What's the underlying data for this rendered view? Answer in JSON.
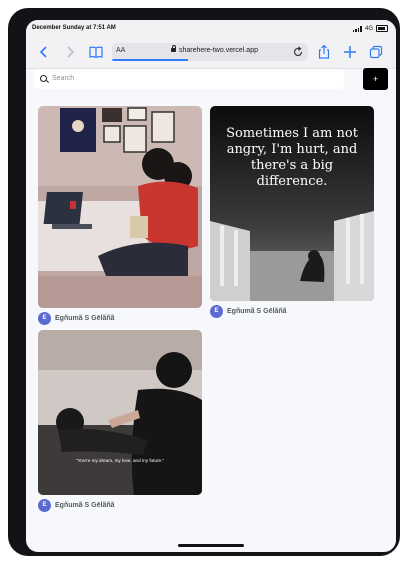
{
  "status_bar": {
    "datetime": "December Sunday at 7:51 AM",
    "network": "4G"
  },
  "browser": {
    "text_size_label": "AA",
    "url": "sharehere-two.vercel.app",
    "icons": [
      "back-icon",
      "forward-icon",
      "bookmarks-icon",
      "lock-icon",
      "reload-icon",
      "share-icon",
      "new-tab-icon",
      "tabs-icon"
    ]
  },
  "header": {
    "search_placeholder": "Search",
    "add_label": "+"
  },
  "pins": [
    {
      "author_initial": "E",
      "author_name": "Egñumã S Gēlãñã"
    },
    {
      "quote": "Sometimes I am not angry, I'm hurt, and there's a big difference.",
      "author_initial": "E",
      "author_name": "Egñumã S Gēlãñã"
    },
    {
      "caption": "\"You're my dream, my love, and my future.\"",
      "author_initial": "E",
      "author_name": "Egñumã S Gēlãñã"
    }
  ],
  "colors": {
    "accent": "#2f7cf6",
    "avatar": "#5b6bd1",
    "add_button": "#000000"
  }
}
